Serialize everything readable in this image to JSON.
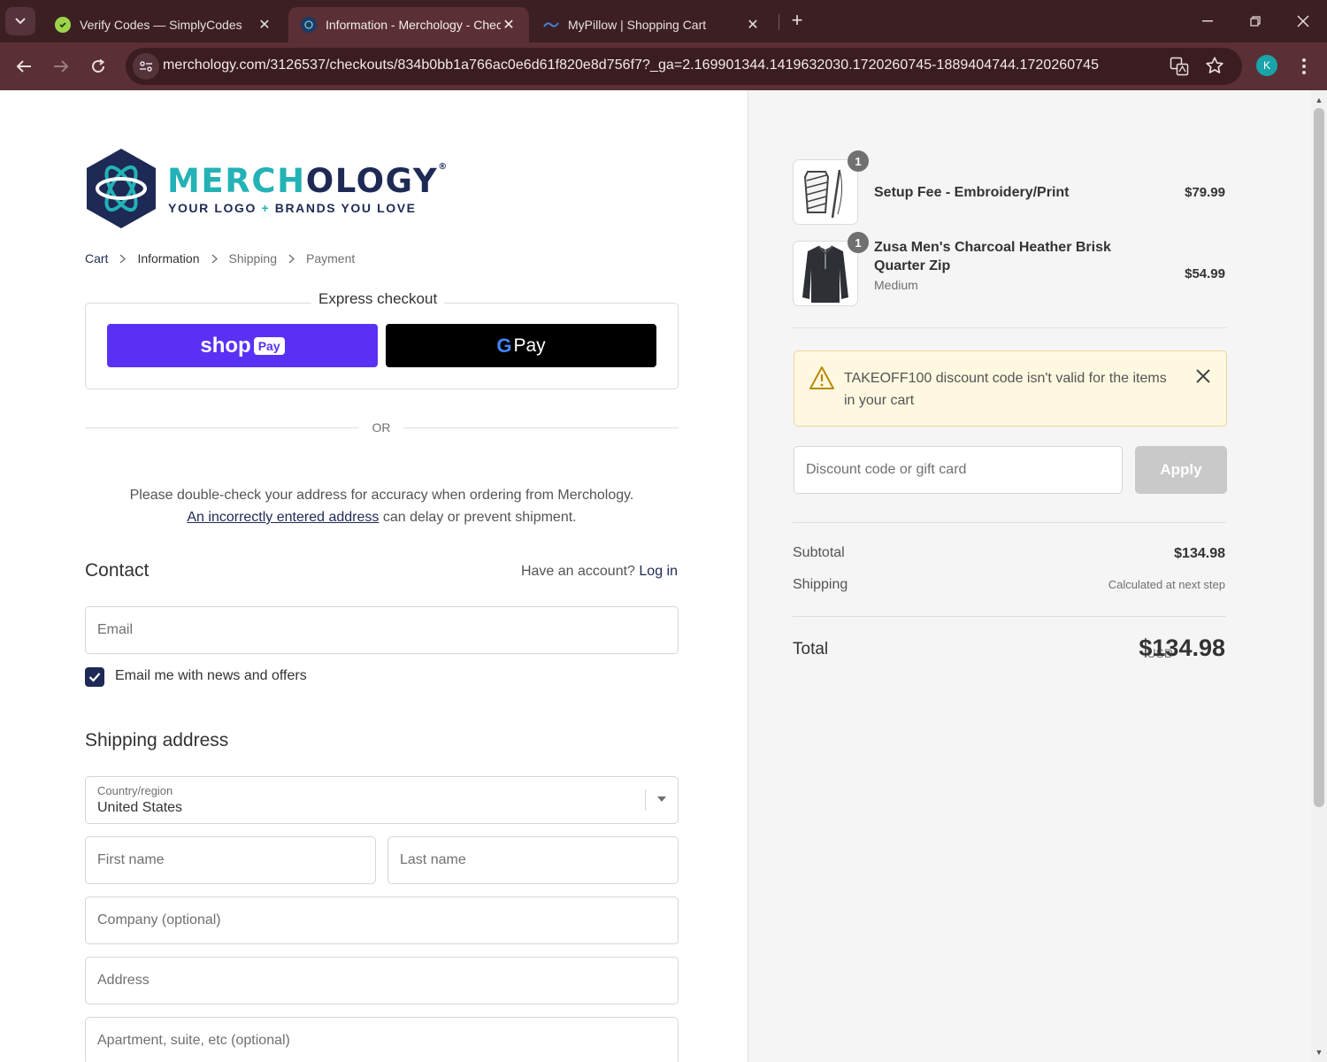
{
  "browser": {
    "tabs": [
      {
        "title": "Verify Codes — SimplyCodes",
        "icon": "simplycodes-icon",
        "active": false
      },
      {
        "title": "Information - Merchology - Checkout",
        "icon": "merchology-icon",
        "active": true
      },
      {
        "title": "MyPillow | Shopping Cart",
        "icon": "mypillow-icon",
        "active": false
      }
    ],
    "url": "merchology.com/3126537/checkouts/834b0bb1a766ac0e6d61f820e8d756f7?_ga=2.169901344.1419632030.1720260745-1889404744.1720260745",
    "profile_initial": "K"
  },
  "logo": {
    "word_teal": "MERCH",
    "word_navy": "OLOGY",
    "tm": "®",
    "tagline_left": "YOUR LOGO",
    "tagline_plus": "+",
    "tagline_right": "BRANDS YOU LOVE"
  },
  "breadcrumbs": [
    "Cart",
    "Information",
    "Shipping",
    "Payment"
  ],
  "express": {
    "title": "Express checkout",
    "shoppay_word": "shop",
    "shoppay_pill": "Pay",
    "gpay_g": "G",
    "gpay_word": "Pay",
    "or": "OR"
  },
  "notice": {
    "line1": "Please double-check your address for accuracy when ordering from Merchology.",
    "link": "An incorrectly entered address",
    "line2_rest": " can delay or prevent shipment."
  },
  "contact": {
    "heading": "Contact",
    "have_account": "Have an account?",
    "login": "Log in",
    "email_placeholder": "Email",
    "newsletter_label": "Email me with news and offers",
    "newsletter_checked": true
  },
  "shipping": {
    "heading": "Shipping address",
    "country_label": "Country/region",
    "country_value": "United States",
    "first_name": "First name",
    "last_name": "Last name",
    "company": "Company (optional)",
    "address": "Address",
    "apartment": "Apartment, suite, etc (optional)"
  },
  "cart": {
    "items": [
      {
        "name": "Setup Fee - Embroidery/Print",
        "variant": "",
        "qty": "1",
        "price": "$79.99",
        "image": "thread-spool-icon"
      },
      {
        "name": "Zusa Men's Charcoal Heather Brisk Quarter Zip",
        "variant": "Medium",
        "qty": "1",
        "price": "$54.99",
        "image": "quarter-zip-jacket-icon"
      }
    ],
    "alert": "TAKEOFF100 discount code isn't valid for the items in your cart",
    "discount_placeholder": "Discount code or gift card",
    "apply": "Apply",
    "subtotal_label": "Subtotal",
    "subtotal_value": "$134.98",
    "shipping_label": "Shipping",
    "shipping_value": "Calculated at next step",
    "total_label": "Total",
    "currency": "USD",
    "total_value": "$134.98"
  },
  "colors": {
    "navy": "#1e2a55",
    "teal": "#23b2b5",
    "shoppay": "#5a31f4",
    "chrome": "#5a2f35"
  }
}
